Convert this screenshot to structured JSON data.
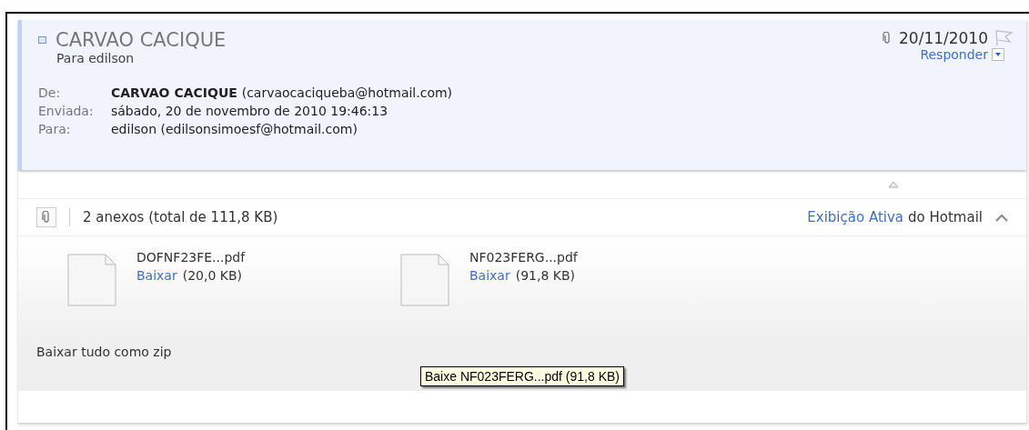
{
  "message": {
    "subject": "CARVAO CACIQUE",
    "recipient_line": "Para edilson",
    "date": "20/11/2010",
    "reply_label": "Responder",
    "flagged": false,
    "fields": [
      {
        "label": "De:",
        "name": "CARVAO CACIQUE",
        "value": "(carvaocaciqueba@hotmail.com)"
      },
      {
        "label": "Enviada:",
        "value": "sábado, 20 de novembro de 2010 19:46:13"
      },
      {
        "label": "Para:",
        "value": "edilson (edilsonsimoesf@hotmail.com)"
      }
    ]
  },
  "attachments": {
    "summary": "2 anexos (total de 111,8 KB)",
    "active_view_link": "Exibição Ativa",
    "active_view_suffix": "do Hotmail",
    "expanded": true,
    "files": [
      {
        "name": "DOFNF23FE...pdf",
        "download": "Baixar",
        "size": "(20,0 KB)"
      },
      {
        "name": "NF023FERG...pdf",
        "download": "Baixar",
        "size": "(91,8 KB)"
      }
    ],
    "zip_link": "Baixar tudo como zip"
  },
  "tooltip": "Baixe NF023FERG...pdf (91,8 KB)"
}
